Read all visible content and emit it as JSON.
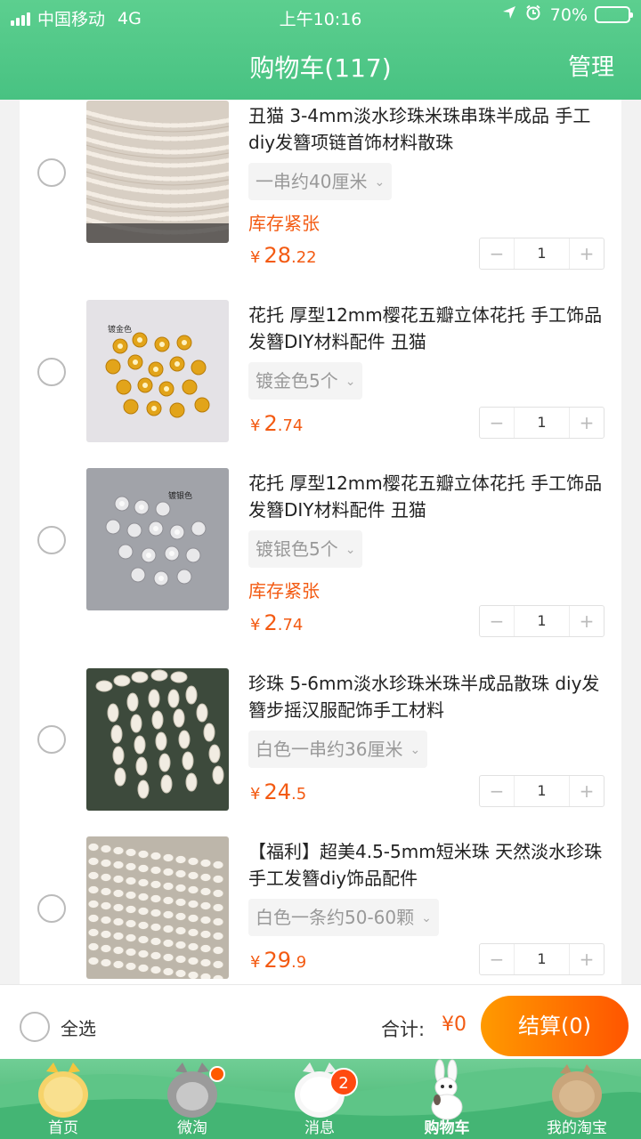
{
  "status_bar": {
    "carrier": "中国移动",
    "network": "4G",
    "time": "上午10:16",
    "battery": "70%",
    "battery_level": 0.7
  },
  "nav": {
    "title": "购物车(117)",
    "manage_label": "管理"
  },
  "items": [
    {
      "title": "丑猫 3-4mm淡水珍珠米珠串珠半成品 手工diy发簪项链首饰材料散珠",
      "sku": "一串约40厘米",
      "stock_note": "库存紧张",
      "currency": "¥",
      "price_int": "28",
      "price_dec": ".22",
      "quantity": "1",
      "image": "pearl-strands-image"
    },
    {
      "title": "花托 厚型12mm樱花五瓣立体花托 手工饰品发簪DIY材料配件 丑猫",
      "sku": "镀金色5个",
      "stock_note": "",
      "currency": "¥",
      "price_int": "2",
      "price_dec": ".74",
      "quantity": "1",
      "image": "gold-flower-caps-image",
      "image_caption": "镀金色"
    },
    {
      "title": "花托 厚型12mm樱花五瓣立体花托 手工饰品发簪DIY材料配件 丑猫",
      "sku": "镀银色5个",
      "stock_note": "库存紧张",
      "currency": "¥",
      "price_int": "2",
      "price_dec": ".74",
      "quantity": "1",
      "image": "silver-flower-caps-image",
      "image_caption": "镀银色"
    },
    {
      "title": "珍珠 5-6mm淡水珍珠米珠半成品散珠 diy发簪步摇汉服配饰手工材料",
      "sku": "白色一串约36厘米",
      "stock_note": "",
      "currency": "¥",
      "price_int": "24",
      "price_dec": ".5",
      "quantity": "1",
      "image": "rice-pearls-image"
    },
    {
      "title": "【福利】超美4.5-5mm短米珠  天然淡水珍珠 手工发簪diy饰品配件",
      "sku": "白色一条约50-60颗",
      "stock_note": "",
      "currency": "¥",
      "price_int": "29",
      "price_dec": ".9",
      "quantity": "1",
      "image": "short-rice-pearls-image"
    }
  ],
  "stepper": {
    "minus": "−",
    "plus": "+"
  },
  "checkout_bar": {
    "select_all_label": "全选",
    "total_label": "合计:",
    "total_value": "¥0",
    "checkout_label": "结算(0)"
  },
  "tabs": [
    {
      "label": "首页",
      "icon": "yellow-fluffy-cat-icon"
    },
    {
      "label": "微淘",
      "icon": "gray-fluffy-cat-icon",
      "dot": true
    },
    {
      "label": "消息",
      "icon": "white-fluffy-cat-icon",
      "badge": "2"
    },
    {
      "label": "购物车",
      "icon": "rabbit-icon",
      "active": true
    },
    {
      "label": "我的淘宝",
      "icon": "brown-fluffy-cat-icon"
    }
  ],
  "colors": {
    "brand_green": "#48c282",
    "accent_orange": "#f35a12",
    "checkout_gradient_start": "#ff9a00",
    "checkout_gradient_end": "#ff5500"
  }
}
